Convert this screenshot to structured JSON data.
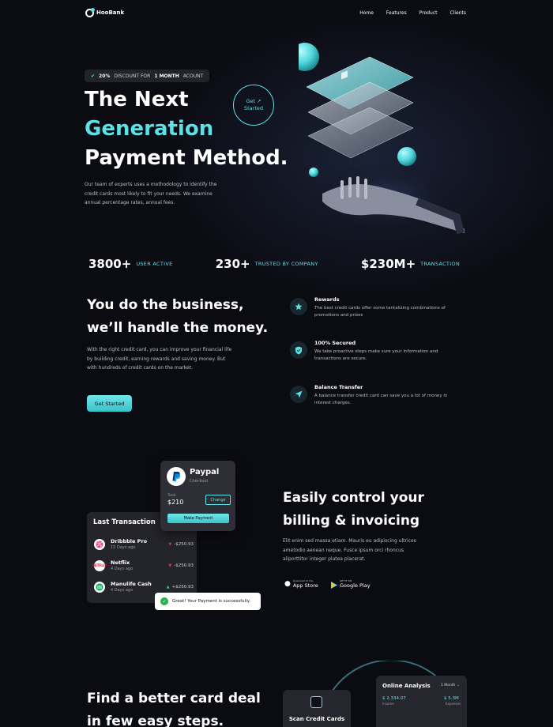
{
  "nav": {
    "brand": "HooBank",
    "links": [
      "Home",
      "Features",
      "Product",
      "Clients"
    ]
  },
  "hero": {
    "badge_discount": "20%",
    "badge_mid": "DISCOUNT FOR",
    "badge_bold": "1 MONTH",
    "badge_end": "ACOUNT",
    "title_line1": "The Next",
    "title_line2": "Generation",
    "title_line3": "Payment Method.",
    "description": "Our team of experts uses a methodology to identify the credit cards most likely to fit your needs. We examine annual percentage rates, annual fees.",
    "cta_line1": "Get ↗",
    "cta_line2": "Started"
  },
  "stats": [
    {
      "value": "3800+",
      "label": "USER ACTIVE"
    },
    {
      "value": "230+",
      "label": "TRUSTED BY COMPANY"
    },
    {
      "value": "$230M+",
      "label": "TRANSACTION"
    }
  ],
  "business": {
    "title_line1": "You do the business,",
    "title_line2": "we’ll handle the money.",
    "description": "With the right credit card, you can improve your financial life by building credit, earning rewards and saving money. But with hundreds of credit cards on the market.",
    "cta": "Get Started",
    "features": [
      {
        "title": "Rewards",
        "desc": "The best credit cards offer some tantalizing combinations of promotions and prizes",
        "icon": "star-icon"
      },
      {
        "title": "100% Secured",
        "desc": "We take proactive steps make sure your information and transactions are secure.",
        "icon": "shield-icon"
      },
      {
        "title": "Balance Transfer",
        "desc": "A balance transfer credit card can save you a lot of money in interest charges.",
        "icon": "send-icon"
      }
    ]
  },
  "billing": {
    "transactions_title": "Last Transaction",
    "transactions": [
      {
        "name": "Dribbble Pro",
        "date": "15 Days ago",
        "amount": "-$250.93",
        "direction": "down"
      },
      {
        "name": "Netflix",
        "date": "4 Days ago",
        "amount": "-$250.93",
        "direction": "down"
      },
      {
        "name": "Manulife Cash",
        "date": "4 Days ago",
        "amount": "+$250.93",
        "direction": "up"
      }
    ],
    "paypal": {
      "name": "Paypal",
      "sub": "Checkout",
      "total_label": "Total",
      "total": "$210",
      "change": "Change",
      "pay": "Make Payment"
    },
    "toast": "Great! Your Payment is successfully.",
    "title_line1": "Easily control your",
    "title_line2": "billing & invoicing",
    "description": "Elit enim sed massa etiam. Mauris eu adipiscing ultrices ametodio aenean neque. Fusce ipsum orci rhoncus aliporttitor integer platea placerat.",
    "appstore_small": "Download on the",
    "appstore": "App Store",
    "googleplay_small": "GET IT ON",
    "googleplay": "Google Play"
  },
  "steps": {
    "title_line1": "Find a better card deal",
    "title_line2": "in few easy steps.",
    "scan_label": "Scan Credit Cards",
    "analysis": {
      "title": "Online Analysis",
      "period": "1 Month",
      "value1": "$ 2,334.07",
      "label1": "Income",
      "value2": "$ 5.3M",
      "label2": "Expenses"
    }
  },
  "colors": {
    "accent": "#5ce1e6",
    "background": "#0b0b12",
    "card": "#24242b"
  }
}
